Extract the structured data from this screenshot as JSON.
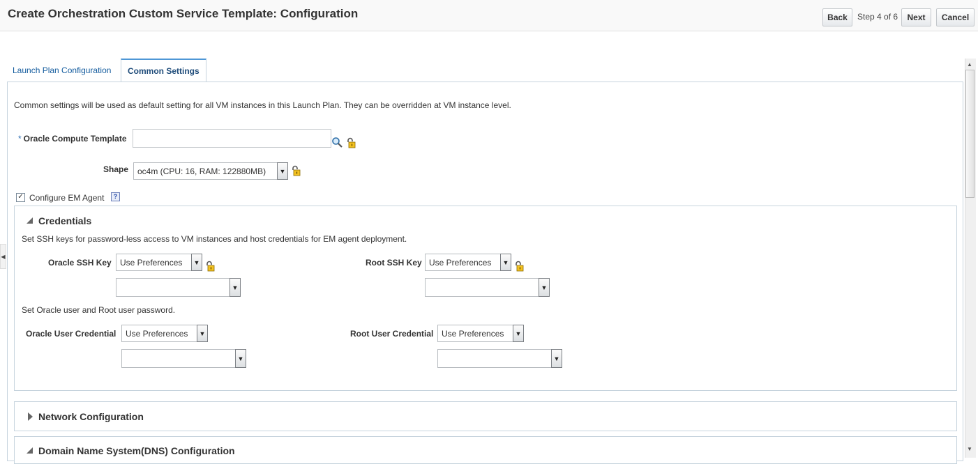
{
  "header": {
    "title": "Create Orchestration Custom Service Template: Configuration",
    "back_label": "Back",
    "step_text": "Step 4 of 6",
    "next_label": "Next",
    "cancel_label": "Cancel"
  },
  "tabs": [
    {
      "label": "Launch Plan Configuration",
      "active": false
    },
    {
      "label": "Common Settings",
      "active": true
    }
  ],
  "intro_text": "Common settings will be used as default setting for all VM instances in this Launch Plan. They can be overridden at VM instance level.",
  "form": {
    "compute_template": {
      "required_marker": "*",
      "label": "Oracle Compute Template",
      "value": ""
    },
    "shape": {
      "label": "Shape",
      "value": "oc4m (CPU: 16, RAM: 122880MB)"
    },
    "configure_em_agent": {
      "label": "Configure EM Agent",
      "checked": true,
      "check_glyph": "✓",
      "help_glyph": "?"
    }
  },
  "credentials": {
    "title": "Credentials",
    "ssh_text": "Set SSH keys for password-less access to VM instances and host credentials for EM agent deployment.",
    "oracle_ssh_key": {
      "label": "Oracle SSH Key",
      "value": "Use Preferences",
      "secondary_value": ""
    },
    "root_ssh_key": {
      "label": "Root SSH Key",
      "value": "Use Preferences",
      "secondary_value": ""
    },
    "password_text": "Set Oracle user and Root user password.",
    "oracle_user_credential": {
      "label": "Oracle User Credential",
      "value": "Use Preferences",
      "secondary_value": ""
    },
    "root_user_credential": {
      "label": "Root User Credential",
      "value": "Use Preferences",
      "secondary_value": ""
    }
  },
  "sections": {
    "network": {
      "title": "Network Configuration",
      "expanded": false
    },
    "dns": {
      "title": "Domain Name System(DNS) Configuration",
      "expanded": true
    }
  },
  "glyphs": {
    "dropdown_arrow": "▼",
    "scroll_up": "▲",
    "scroll_down": "▼",
    "collapse_handle": "◀"
  },
  "icons": [
    "search-icon",
    "lock-icon",
    "help-icon",
    "checkbox-icon",
    "expand-triangle-icon",
    "collapse-triangle-icon"
  ]
}
